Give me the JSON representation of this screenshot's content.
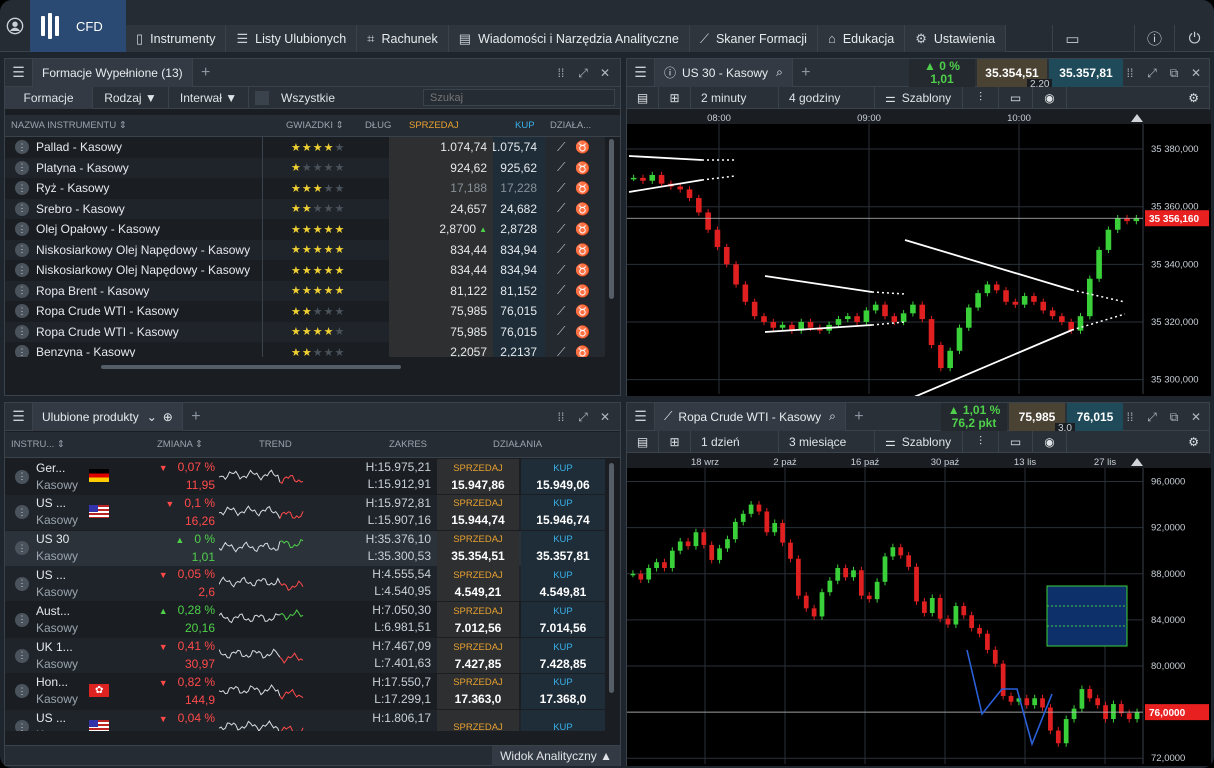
{
  "topbar": {
    "brand": "CFD",
    "tabs": [
      {
        "label": "Instrumenty",
        "icon": "instruments-icon"
      },
      {
        "label": "Listy Ulubionych",
        "icon": "list-icon"
      },
      {
        "label": "Rachunek",
        "icon": "tag-icon"
      },
      {
        "label": "Wiadomości i Narzędzia Analityczne",
        "icon": "news-icon"
      },
      {
        "label": "Skaner Formacji",
        "icon": "scanner-icon"
      },
      {
        "label": "Edukacja",
        "icon": "graduation-icon"
      },
      {
        "label": "Ustawienia",
        "icon": "gear-icon"
      }
    ]
  },
  "patterns": {
    "title": "Formacje Wypełnione (13)",
    "filters": {
      "tab": "Formacje",
      "type": "Rodzaj ▼",
      "interval": "Interwał ▼",
      "all": "Wszystkie",
      "search_placeholder": "Szukaj"
    },
    "headers": {
      "name": "NAZWA INSTRUMENTU ⇕",
      "stars": "GWIAZDKI ⇕",
      "length": "DŁUG",
      "sell": "SPRZEDAJ",
      "buy": "KUP",
      "actions": "DZIAŁA..."
    },
    "rows": [
      {
        "name": "Pallad - Kasowy",
        "stars": 4,
        "sell": "1.074,74",
        "buy": "1.075,74",
        "dim": false
      },
      {
        "name": "Platyna - Kasowy",
        "stars": 1,
        "sell": "924,62",
        "buy": "925,62",
        "dim": false
      },
      {
        "name": "Ryż - Kasowy",
        "stars": 3,
        "sell": "17,188",
        "buy": "17,228",
        "dim": true
      },
      {
        "name": "Srebro - Kasowy",
        "stars": 2,
        "sell": "24,657",
        "buy": "24,682",
        "dim": false
      },
      {
        "name": "Olej Opałowy - Kasowy",
        "stars": 5,
        "sell": "2,8700",
        "buy": "2,8728",
        "dim": false,
        "up": true
      },
      {
        "name": "Niskosiarkowy Olej Napędowy - Kasowy",
        "stars": 5,
        "sell": "834,44",
        "buy": "834,94",
        "dim": false
      },
      {
        "name": "Niskosiarkowy Olej Napędowy - Kasowy",
        "stars": 5,
        "sell": "834,44",
        "buy": "834,94",
        "dim": false
      },
      {
        "name": "Ropa Brent - Kasowy",
        "stars": 5,
        "sell": "81,122",
        "buy": "81,152",
        "dim": false
      },
      {
        "name": "Ropa Crude WTI - Kasowy",
        "stars": 2,
        "sell": "75,985",
        "buy": "76,015",
        "dim": false
      },
      {
        "name": "Ropa Crude WTI - Kasowy",
        "stars": 4,
        "sell": "75,985",
        "buy": "76,015",
        "dim": false
      },
      {
        "name": "Benzyna - Kasowy",
        "stars": 2,
        "sell": "2,2057",
        "buy": "2,2137",
        "dim": false
      }
    ]
  },
  "favorites": {
    "title": "Ulubione produkty",
    "headers": {
      "instr": "INSTRU... ⇕",
      "change": "ZMIANA ⇕",
      "trend": "TREND",
      "range": "ZAKRES",
      "actions": "DZIAŁANIA"
    },
    "sell_label": "SPRZEDAJ",
    "buy_label": "KUP",
    "footer": "Widok Analityczny ▲",
    "rows": [
      {
        "name": "Ger...",
        "sub": "Kasowy",
        "flag": "de",
        "pct": "0,07 %",
        "abs": "11,95",
        "dir": "down",
        "hi": "H:15.975,21",
        "lo": "L:15.912,91",
        "sell": "15.947,86",
        "buy": "15.949,06"
      },
      {
        "name": "US ...",
        "sub": "Kasowy",
        "flag": "us",
        "pct": "0,1 %",
        "abs": "16,26",
        "dir": "down",
        "hi": "H:15.972,81",
        "lo": "L:15.907,16",
        "sell": "15.944,74",
        "buy": "15.946,74"
      },
      {
        "name": "US 30",
        "sub": "Kasowy",
        "flag": "",
        "pct": "0 %",
        "abs": "1,01",
        "dir": "up",
        "hi": "H:35.376,10",
        "lo": "L:35.300,53",
        "sell": "35.354,51",
        "buy": "35.357,81"
      },
      {
        "name": "US ...",
        "sub": "Kasowy",
        "flag": "",
        "pct": "0,05 %",
        "abs": "2,6",
        "dir": "down",
        "hi": "H:4.555,54",
        "lo": "L:4.540,95",
        "sell": "4.549,21",
        "buy": "4.549,81"
      },
      {
        "name": "Aust...",
        "sub": "Kasowy",
        "flag": "",
        "pct": "0,28 %",
        "abs": "20,16",
        "dir": "up",
        "hi": "H:7.050,30",
        "lo": "L:6.981,51",
        "sell": "7.012,56",
        "buy": "7.014,56"
      },
      {
        "name": "UK 1...",
        "sub": "Kasowy",
        "flag": "",
        "pct": "0,41 %",
        "abs": "30,97",
        "dir": "down",
        "hi": "H:7.467,09",
        "lo": "L:7.401,63",
        "sell": "7.427,85",
        "buy": "7.428,85"
      },
      {
        "name": "Hon...",
        "sub": "Kasowy",
        "flag": "hk",
        "pct": "0,82 %",
        "abs": "144,9",
        "dir": "down",
        "hi": "H:17.550,7",
        "lo": "L:17.299,1",
        "sell": "17.363,0",
        "buy": "17.368,0"
      },
      {
        "name": "US ...",
        "sub": "Kasowy",
        "flag": "us",
        "pct": "0,04 %",
        "abs": "",
        "dir": "down",
        "hi": "H:1.806,17",
        "lo": "",
        "sell": "",
        "buy": ""
      }
    ]
  },
  "chart1": {
    "title": "US 30 - Kasowy",
    "change": "▲ 0 %",
    "change_abs": "1,01",
    "sell": "35.354,51",
    "buy": "35.357,81",
    "spread": "2,20",
    "interval": "2 minuty",
    "period": "4 godziny",
    "templates": "Szablony",
    "last_price": "35 356,160",
    "chart_data": {
      "type": "line",
      "x_ticks": [
        "08:00",
        "09:00",
        "10:00"
      ],
      "y_ticks": [
        "35 380,000",
        "35 360,000",
        "35 340,000",
        "35 320,000",
        "35 300,000"
      ],
      "ylim": [
        35295,
        35388
      ],
      "values": [
        35370,
        35369,
        35371,
        35368,
        35367,
        35366,
        35363,
        35358,
        35352,
        35346,
        35340,
        35333,
        35327,
        35322,
        35320,
        35318,
        35319,
        35317,
        35320,
        35318,
        35317,
        35319,
        35321,
        35322,
        35320,
        35324,
        35326,
        35322,
        35320,
        35323,
        35326,
        35321,
        35312,
        35304,
        35310,
        35318,
        35325,
        35330,
        35333,
        35331,
        35327,
        35326,
        35329,
        35327,
        35324,
        35322,
        35320,
        35317,
        35322,
        35335,
        35345,
        35352,
        35356,
        35355,
        35356
      ]
    }
  },
  "chart2": {
    "title": "Ropa Crude WTI - Kasowy",
    "change": "▲ 1,01 %",
    "change_abs": "76,2 pkt",
    "sell": "75,985",
    "buy": "76,015",
    "spread": "3,0",
    "interval": "1 dzień",
    "period": "3 miesiące",
    "templates": "Szablony",
    "last_price": "76,0000",
    "chart_data": {
      "type": "line",
      "x_ticks": [
        "18 wrz",
        "2 paź",
        "16 paź",
        "30 paź",
        "13 lis",
        "27 lis"
      ],
      "y_ticks": [
        "96,0000",
        "92,0000",
        "88,0000",
        "84,0000",
        "80,0000",
        "76,0000",
        "72,0000"
      ],
      "ylim": [
        71.5,
        97
      ],
      "values": [
        88,
        87.5,
        88.5,
        89,
        88.5,
        90,
        90.8,
        90.4,
        91.6,
        90.5,
        89.2,
        90.2,
        91,
        92.5,
        93.2,
        94,
        93.4,
        91.6,
        92.4,
        90.7,
        89.3,
        86.1,
        85,
        84.3,
        86.4,
        87.4,
        88.5,
        87.7,
        88.3,
        86.1,
        85.8,
        87.3,
        89.5,
        90.3,
        89.6,
        88.6,
        85.6,
        84.6,
        85.9,
        84.1,
        83.6,
        85.2,
        84.4,
        83.3,
        82.8,
        81.4,
        80.2,
        77.4,
        76.9,
        77.2,
        76.6,
        77.2,
        76.4,
        74.4,
        73.3,
        75.4,
        76.3,
        78,
        77.2,
        76.6,
        75.4,
        76.7,
        75.9,
        75.4,
        76
      ]
    }
  }
}
